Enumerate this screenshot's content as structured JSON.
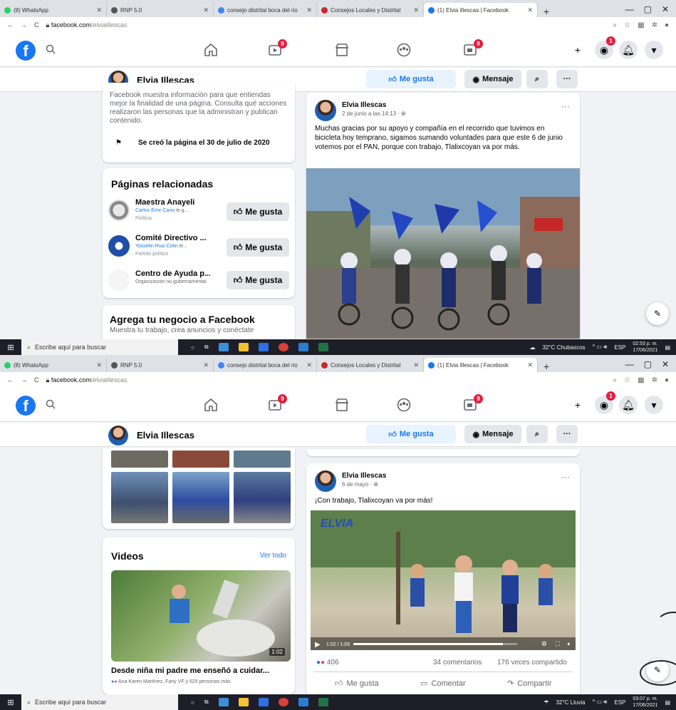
{
  "taskbar": {
    "search_placeholder": "Escribe aquí para buscar"
  },
  "top": {
    "tabs": [
      {
        "label": "(8) WhatsApp",
        "color": "#25d366"
      },
      {
        "label": "RNP 5.0",
        "color": "#555555"
      },
      {
        "label": "consejo distrital boca del rio",
        "color": "#4285f4"
      },
      {
        "label": "Consejos Locales y Distrital",
        "color": "#c62828"
      },
      {
        "label": "(1) Elvia Illescas | Facebook",
        "color": "#1877f2"
      }
    ],
    "url_host": "facebook.com",
    "url_path": "/elviaillescas",
    "nav_badges": {
      "watch": "9",
      "groups": "9",
      "messenger": "1"
    },
    "page_name": "Elvia Illescas",
    "like_label": "Me gusta",
    "message_label": "Mensaje",
    "transparency_text": "Facebook muestra información para que entiendas mejor la finalidad de una página. Consulta qué acciones realizaron las personas que la administran y publican contenido.",
    "created_text": "Se creó la página el 30 de julio de 2020",
    "related": {
      "title": "Páginas relacionadas",
      "items": [
        {
          "name": "Maestra Anayeli",
          "sub_link": "Carlos Emir Cano",
          "sub_rest": " le g...",
          "tag": "Política",
          "btn": "Me gusta"
        },
        {
          "name": "Comité Directivo ...",
          "sub_link": "Yosselin Ruiz Colin",
          "sub_rest": " le...",
          "tag": "Partido político",
          "btn": "Me gusta"
        },
        {
          "name": "Centro de Ayuda p...",
          "sub_link": "",
          "sub_rest": "Organización no gubernamental",
          "tag": "",
          "btn": "Me gusta"
        }
      ]
    },
    "biz": {
      "title": "Agrega tu negocio a Facebook",
      "text": "Muestra tu trabajo, crea anuncios y conéctate"
    },
    "post": {
      "author": "Elvia Illescas",
      "meta": "2 de junio a las 14:13 · ",
      "text": "Muchas gracias por su apoyo y compañía en el recorrido que tuvimos en bicicleta hoy temprano, sigamos sumando voluntades para que este 6 de junio votemos por el PAN, porque con trabajo, Tlalixcoyan va por más."
    },
    "tray": {
      "weather": "32°C Chubascos",
      "lang": "ESP",
      "time": "02:53 p. m.",
      "date": "17/06/2021"
    }
  },
  "bottom": {
    "tabs": [
      {
        "label": "(8) WhatsApp",
        "color": "#25d366"
      },
      {
        "label": "RNP 5.0",
        "color": "#555555"
      },
      {
        "label": "consejo distrital boca del rio",
        "color": "#4285f4"
      },
      {
        "label": "Consejos Locales y Distrital",
        "color": "#c62828"
      },
      {
        "label": "(1) Elvia Illescas | Facebook",
        "color": "#1877f2"
      }
    ],
    "url_host": "facebook.com",
    "url_path": "/elviaillescas",
    "nav_badges": {
      "watch": "9",
      "groups": "9",
      "messenger": "1"
    },
    "page_name": "Elvia Illescas",
    "like_label": "Me gusta",
    "message_label": "Mensaje",
    "videos": {
      "title": "Videos",
      "see_all": "Ver todo",
      "duration": "1:02",
      "caption": "Desde niña mi padre me enseñó a cuidar...",
      "reactions": "Ana Karen Martínez, Fany VF y 625 personas más"
    },
    "post": {
      "author": "Elvia Illescas",
      "meta": "6 de mayo · ",
      "text": "¡Con trabajo, Tlalixcoyan va por más!",
      "video_overlay": "ELVIA",
      "video_time": "1:02 / 1:05",
      "reaction_count": "406",
      "comments": "34 comentarios",
      "shares": "176 veces compartido",
      "actions": {
        "like": "Me gusta",
        "comment": "Comentar",
        "share": "Compartir"
      }
    },
    "tray": {
      "weather": "32°C Lluvia",
      "lang": "ESP",
      "time": "03:07 p. m.",
      "date": "17/06/2021"
    }
  }
}
